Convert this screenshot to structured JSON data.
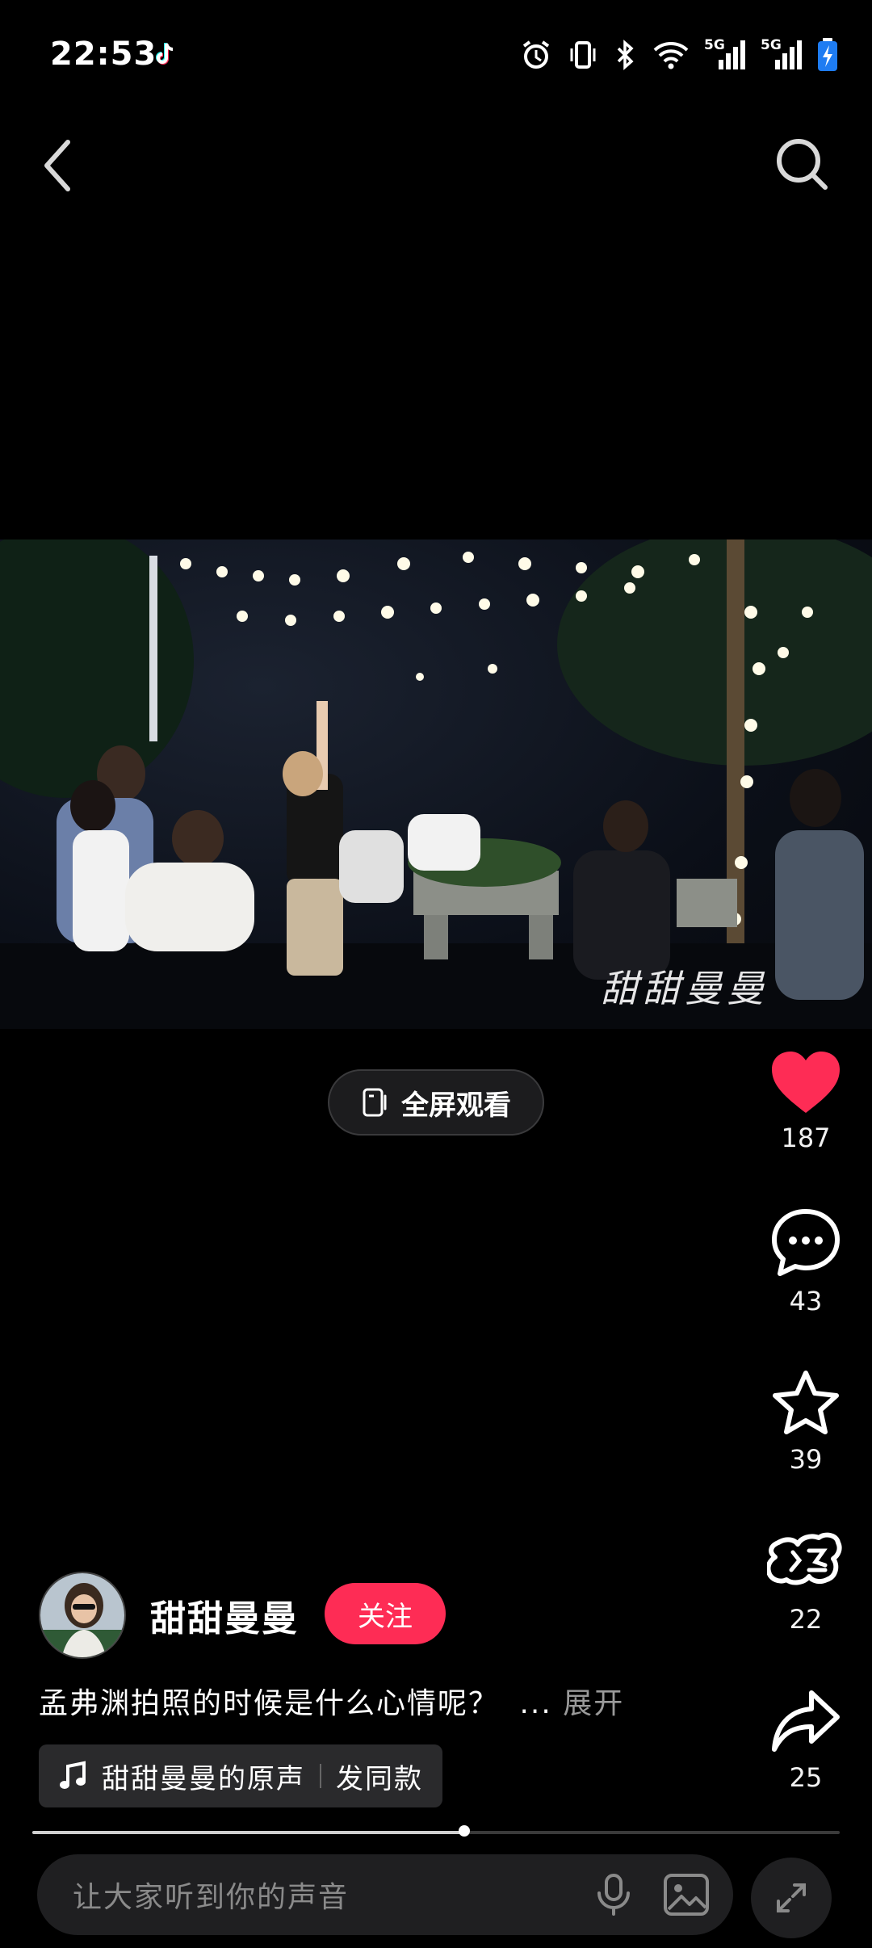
{
  "status_bar": {
    "time": "22:53",
    "icons": [
      "tiktok-icon",
      "alarm-icon",
      "vibrate-icon",
      "bluetooth-icon",
      "wifi-icon",
      "signal-5g-icon",
      "signal-5g-icon",
      "battery-charging-icon"
    ],
    "network_1": "5G",
    "network_2": "5G"
  },
  "nav": {
    "back_icon": "chevron-left-icon",
    "search_icon": "search-icon"
  },
  "video": {
    "watermark": "甜甜曼曼"
  },
  "fullscreen": {
    "label": "全屏观看"
  },
  "actions": {
    "like": {
      "count": "187",
      "color": "#fe2c55"
    },
    "comment": {
      "count": "43"
    },
    "favorite": {
      "count": "39"
    },
    "gift": {
      "count": "22"
    },
    "share": {
      "count": "25"
    }
  },
  "author": {
    "name": "甜甜曼曼",
    "follow_label": "关注"
  },
  "caption": {
    "text": "孟弗渊拍照的时候是什么心情呢？",
    "ellipsis": "...",
    "expand_label": "展开"
  },
  "music": {
    "title": "甜甜曼曼的原声",
    "use_sound_label": "发同款"
  },
  "playback": {
    "progress": 0.535
  },
  "comment_bar": {
    "placeholder": "让大家听到你的声音"
  },
  "colors": {
    "accent": "#fe2c55",
    "background": "#000000"
  }
}
